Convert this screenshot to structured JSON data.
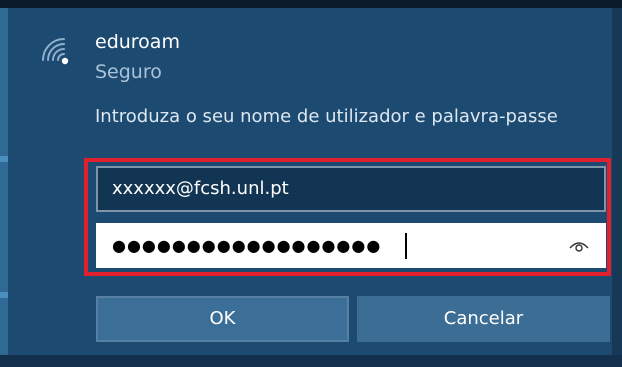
{
  "network": {
    "name": "eduroam",
    "status": "Seguro",
    "icon": "wifi-secured-icon"
  },
  "prompt": {
    "instruction": "Introduza o seu nome de utilizador e palavra-passe"
  },
  "form": {
    "username_value": "xxxxxx@fcsh.unl.pt",
    "password_masked": "●●●●●●●●●●●●●●●●●●",
    "reveal_icon": "eye-icon"
  },
  "buttons": {
    "ok_label": "OK",
    "cancel_label": "Cancelar"
  },
  "colors": {
    "dialog_background": "#1d4a70",
    "highlight_border": "#e0202c",
    "button_background": "#3b6d95"
  }
}
